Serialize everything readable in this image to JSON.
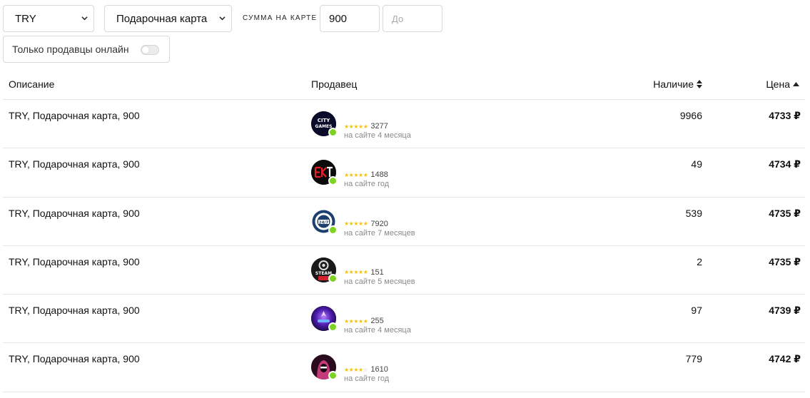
{
  "filters": {
    "currency": "TRY",
    "card_type": "Подарочная карта",
    "sum_label": "СУММА НА КАРТЕ",
    "sum_from": "900",
    "sum_to_placeholder": "До",
    "online_only_label": "Только продавцы онлайн",
    "online_only_enabled": false
  },
  "table": {
    "headers": {
      "description": "Описание",
      "seller": "Продавец",
      "stock": "Наличие",
      "price": "Цена"
    },
    "rows": [
      {
        "description": "TRY, Подарочная карта, 900",
        "seller_avatar": "city-games-logo",
        "stars": 5,
        "reviews": "3277",
        "since": "на сайте 4 месяца",
        "stock": "9966",
        "price": "4733 ₽"
      },
      {
        "description": "TRY, Подарочная карта, 900",
        "seller_avatar": "ekt-logo",
        "stars": 5,
        "reviews": "1488",
        "since": "на сайте год",
        "stock": "49",
        "price": "4734 ₽"
      },
      {
        "description": "TRY, Подарочная карта, 900",
        "seller_avatar": "24-7-badge-logo",
        "stars": 5,
        "reviews": "7920",
        "since": "на сайте 7 месяцев",
        "stock": "539",
        "price": "4735 ₽"
      },
      {
        "description": "TRY, Подарочная карта, 900",
        "seller_avatar": "steam-turkey-logo",
        "stars": 5,
        "reviews": "151",
        "since": "на сайте 5 месяцев",
        "stock": "2",
        "price": "4735 ₽"
      },
      {
        "description": "TRY, Подарочная карта, 900",
        "seller_avatar": "neon-game-logo",
        "stars": 5,
        "reviews": "255",
        "since": "на сайте 4 месяца",
        "stock": "97",
        "price": "4739 ₽"
      },
      {
        "description": "TRY, Подарочная карта, 900",
        "seller_avatar": "hooded-figure-avatar",
        "stars": 4,
        "reviews": "1610",
        "since": "на сайте год",
        "stock": "779",
        "price": "4742 ₽"
      }
    ]
  },
  "colors": {
    "online_dot": "#7ed321",
    "star": "#f4c20d",
    "border": "#e6e6e6"
  }
}
